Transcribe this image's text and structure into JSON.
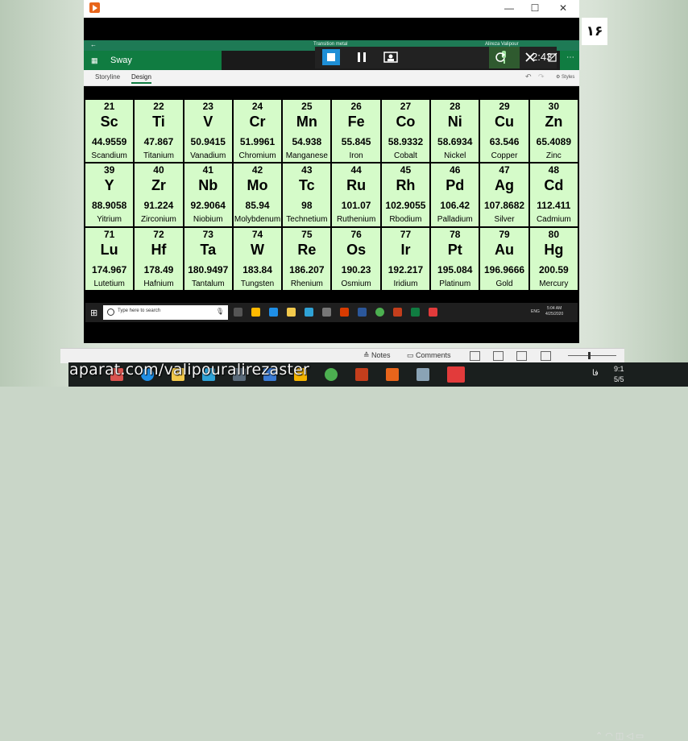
{
  "slide_number": "۱۶",
  "window": {
    "minimize": "—",
    "maximize": "☐",
    "close": "✕"
  },
  "sway": {
    "doc_title": "Transition metal",
    "user": "Alireza Valipour",
    "app_name": "Sway",
    "tabs": [
      "Storyline",
      "Design"
    ],
    "styles_label": "Styles"
  },
  "recorder": {
    "time": "2:43"
  },
  "elements": [
    {
      "number": "21",
      "symbol": "Sc",
      "mass": "44.9559",
      "name": "Scandium"
    },
    {
      "number": "22",
      "symbol": "Ti",
      "mass": "47.867",
      "name": "Titanium"
    },
    {
      "number": "23",
      "symbol": "V",
      "mass": "50.9415",
      "name": "Vanadium"
    },
    {
      "number": "24",
      "symbol": "Cr",
      "mass": "51.9961",
      "name": "Chromium"
    },
    {
      "number": "25",
      "symbol": "Mn",
      "mass": "54.938",
      "name": "Manganese"
    },
    {
      "number": "26",
      "symbol": "Fe",
      "mass": "55.845",
      "name": "Iron"
    },
    {
      "number": "27",
      "symbol": "Co",
      "mass": "58.9332",
      "name": "Cobalt"
    },
    {
      "number": "28",
      "symbol": "Ni",
      "mass": "58.6934",
      "name": "Nickel"
    },
    {
      "number": "29",
      "symbol": "Cu",
      "mass": "63.546",
      "name": "Copper"
    },
    {
      "number": "30",
      "symbol": "Zn",
      "mass": "65.4089",
      "name": "Zinc"
    },
    {
      "number": "39",
      "symbol": "Y",
      "mass": "88.9058",
      "name": "Yitrium"
    },
    {
      "number": "40",
      "symbol": "Zr",
      "mass": "91.224",
      "name": "Zirconium"
    },
    {
      "number": "41",
      "symbol": "Nb",
      "mass": "92.9064",
      "name": "Niobium"
    },
    {
      "number": "42",
      "symbol": "Mo",
      "mass": "85.94",
      "name": "Molybdenum"
    },
    {
      "number": "43",
      "symbol": "Tc",
      "mass": "98",
      "name": "Technetium"
    },
    {
      "number": "44",
      "symbol": "Ru",
      "mass": "101.07",
      "name": "Ruthenium"
    },
    {
      "number": "45",
      "symbol": "Rh",
      "mass": "102.9055",
      "name": "Rbodium"
    },
    {
      "number": "46",
      "symbol": "Pd",
      "mass": "106.42",
      "name": "Palladium"
    },
    {
      "number": "47",
      "symbol": "Ag",
      "mass": "107.8682",
      "name": "Silver"
    },
    {
      "number": "48",
      "symbol": "Cd",
      "mass": "112.411",
      "name": "Cadmium"
    },
    {
      "number": "71",
      "symbol": "Lu",
      "mass": "174.967",
      "name": "Lutetium"
    },
    {
      "number": "72",
      "symbol": "Hf",
      "mass": "178.49",
      "name": "Hafnium"
    },
    {
      "number": "73",
      "symbol": "Ta",
      "mass": "180.9497",
      "name": "Tantalum"
    },
    {
      "number": "74",
      "symbol": "W",
      "mass": "183.84",
      "name": "Tungsten"
    },
    {
      "number": "75",
      "symbol": "Re",
      "mass": "186.207",
      "name": "Rhenium"
    },
    {
      "number": "76",
      "symbol": "Os",
      "mass": "190.23",
      "name": "Osmium"
    },
    {
      "number": "77",
      "symbol": "Ir",
      "mass": "192.217",
      "name": "Iridium"
    },
    {
      "number": "78",
      "symbol": "Pt",
      "mass": "195.084",
      "name": "Platinum"
    },
    {
      "number": "79",
      "symbol": "Au",
      "mass": "196.9666",
      "name": "Gold"
    },
    {
      "number": "80",
      "symbol": "Hg",
      "mass": "200.59",
      "name": "Mercury"
    }
  ],
  "inner_taskbar": {
    "search_placeholder": "Type here to search",
    "lang": "ENG",
    "time": "5:04 AM",
    "date": "4/25/2020"
  },
  "ppt_status": {
    "notes": "Notes",
    "comments": "Comments"
  },
  "host_taskbar": {
    "watermark": "aparat.com/valipouralirezaster",
    "lang": "فا",
    "time": "9:1",
    "date": "5/5"
  },
  "colors": {
    "cell_bg": "#d5fbc9",
    "sway_green": "#107c41",
    "stop_blue": "#1e8fd6"
  }
}
